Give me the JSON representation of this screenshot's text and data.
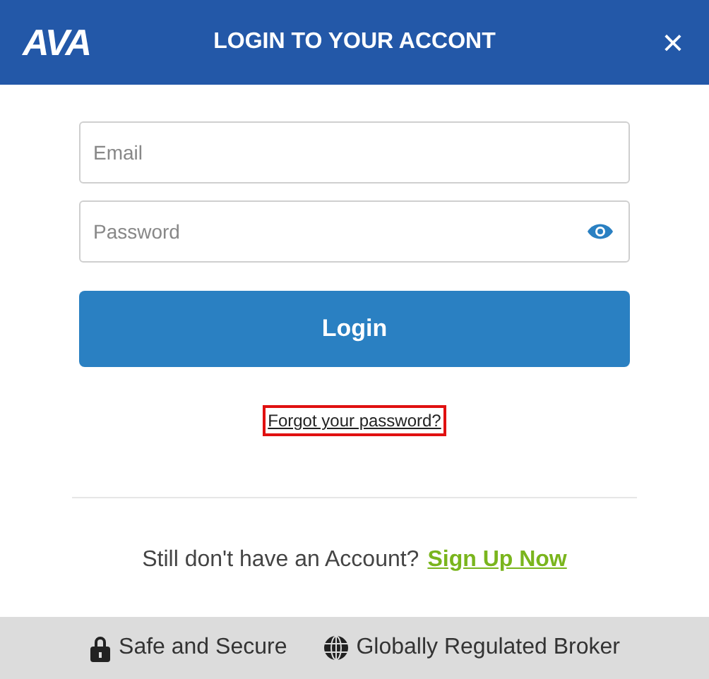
{
  "header": {
    "logo": "AVA",
    "title": "LOGIN TO YOUR ACCONT",
    "close": "×"
  },
  "form": {
    "email": {
      "placeholder": "Email"
    },
    "password": {
      "placeholder": "Password"
    },
    "login_button": "Login",
    "forgot_link": {
      "label": "Forgot your password?",
      "focused": true
    }
  },
  "signup": {
    "text": "Still don't have an Account?",
    "link": "Sign Up Now"
  },
  "footer": [
    {
      "kind": "lock",
      "label": "Safe and Secure"
    },
    {
      "kind": "globe",
      "label": "Globally Regulated Broker"
    }
  ]
}
